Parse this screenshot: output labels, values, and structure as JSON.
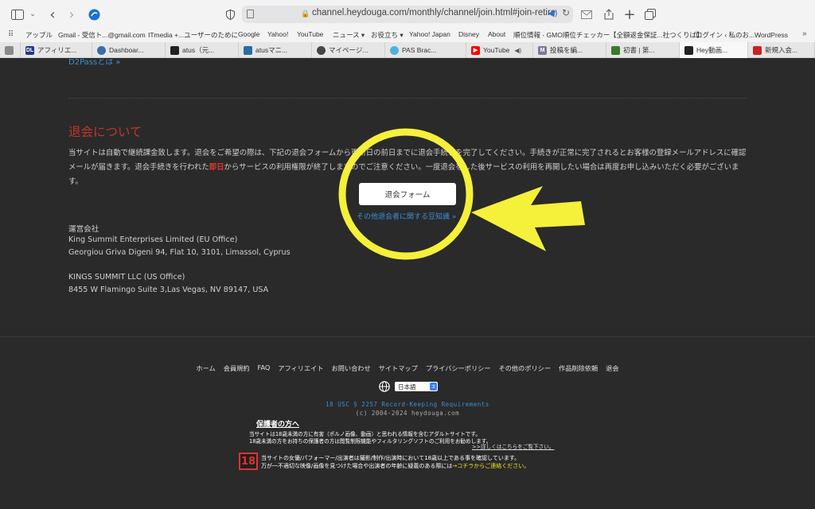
{
  "browser": {
    "url": "channel.heydouga.com/monthly/channel/join.html#join-retire",
    "bookmarks": [
      "アップル",
      "Gmail - 受信ト...@gmail.com",
      "ITmedia +...ユーザーのために",
      "Google",
      "Yahoo!",
      "YouTube",
      "ニュース ▾",
      "お役立ち ▾",
      "Yahoo! Japan",
      "Disney",
      "About",
      "順位情報 - GMO順位チェッカー",
      "【全額返金保証...社つくりば】",
      "ログイン ‹ 私のお...WordPress"
    ],
    "tabs": [
      {
        "title": "",
        "color": "#8a8a8a",
        "glyph": ""
      },
      {
        "title": "アフィリエ...",
        "color": "#1e3a8a",
        "glyph": "DL"
      },
      {
        "title": "Dashboar...",
        "color": "#3b6ea5",
        "glyph": ""
      },
      {
        "title": "atus（元...",
        "color": "#222222",
        "glyph": ""
      },
      {
        "title": "atusマニ...",
        "color": "#2b6ca3",
        "glyph": ""
      },
      {
        "title": "マイページ...",
        "color": "#444444",
        "glyph": ""
      },
      {
        "title": "PAS Brac...",
        "color": "#4fb3d9",
        "glyph": ""
      },
      {
        "title": "YouTube",
        "color": "#ff0000",
        "glyph": "▶"
      },
      {
        "title": "投稿を編...",
        "color": "#7a7a9a",
        "glyph": "M"
      },
      {
        "title": "初書 | 第...",
        "color": "#3a7a2a",
        "glyph": ""
      },
      {
        "title": "Hey動画...",
        "color": "#222222",
        "glyph": ""
      },
      {
        "title": "新規入会...",
        "color": "#cc2222",
        "glyph": ""
      }
    ]
  },
  "page": {
    "d2pass_link": "D2Passとは »",
    "retire": {
      "heading": "退会について",
      "body_pre": "当サイトは自動で継続課金致します。退会をご希望の際は、下記の退会フォームから更新日の前日までに退会手続きを完了してください。手続きが正常に完了されるとお客様の登録メールアドレスに確認メールが届きます。退会手続きを行われた",
      "body_emph": "即日",
      "body_post": "からサービスの利用権限が終了しますのでご注意ください。一度退会をした後サービスの利用を再開したい場合は再度お申し込みいただく必要がございます。",
      "button": "退会フォーム",
      "tips_link": "その他退会者に関する豆知識 »"
    },
    "company": {
      "label": "運営会社",
      "eu_name": "King Summit Enterprises Limited (EU Office)",
      "eu_address": "Georgiou Griva Digeni 94, Flat 10, 3101, Limassol, Cyprus",
      "us_name": "KINGS SUMMIT LLC (US Office)",
      "us_address": "8455 W Flamingo Suite 3,Las Vegas, NV 89147, USA"
    }
  },
  "footer": {
    "nav": [
      "ホーム",
      "会員規約",
      "FAQ",
      "アフィリエイト",
      "お問い合わせ",
      "サイトマップ",
      "プライバシーポリシー",
      "その他のポリシー",
      "作品削除依頼",
      "退会"
    ],
    "language": "日本語",
    "records": "18 USC § 2257 Record-Keeping Requirements",
    "copyright": "(c) 2004-2024 heydouga.com",
    "guardian_heading": "保護者の方へ",
    "guardian_line1": "当サイトは18歳未満の方に有害（ポルノ画像、動画）と思われる情報を含むアダルトサイトです。",
    "guardian_line2": "18歳未満の方をお持ちの保護者の方は閲覧制限機能やフィルタリングソフトのご利用をお勧めします。",
    "guardian_more": ">>詳しくはこちらをご覧下さい。",
    "age_badge": "18",
    "age_line1": "当サイトの女優/パフォーマー/出演者は撮影/制作/出演時において18歳以上である事を確認しています。",
    "age_line2_pre": "万が一不適切な映像/画像を見つけた場合や出演者の年齢に疑義のある際には",
    "age_line2_link": "→コチラからご連絡ください。"
  },
  "colors": {
    "page_bg": "#2a2a2a",
    "heading_red": "#c9342c",
    "link_blue": "#3a8fd6",
    "annotation_yellow": "#f5f03a"
  }
}
